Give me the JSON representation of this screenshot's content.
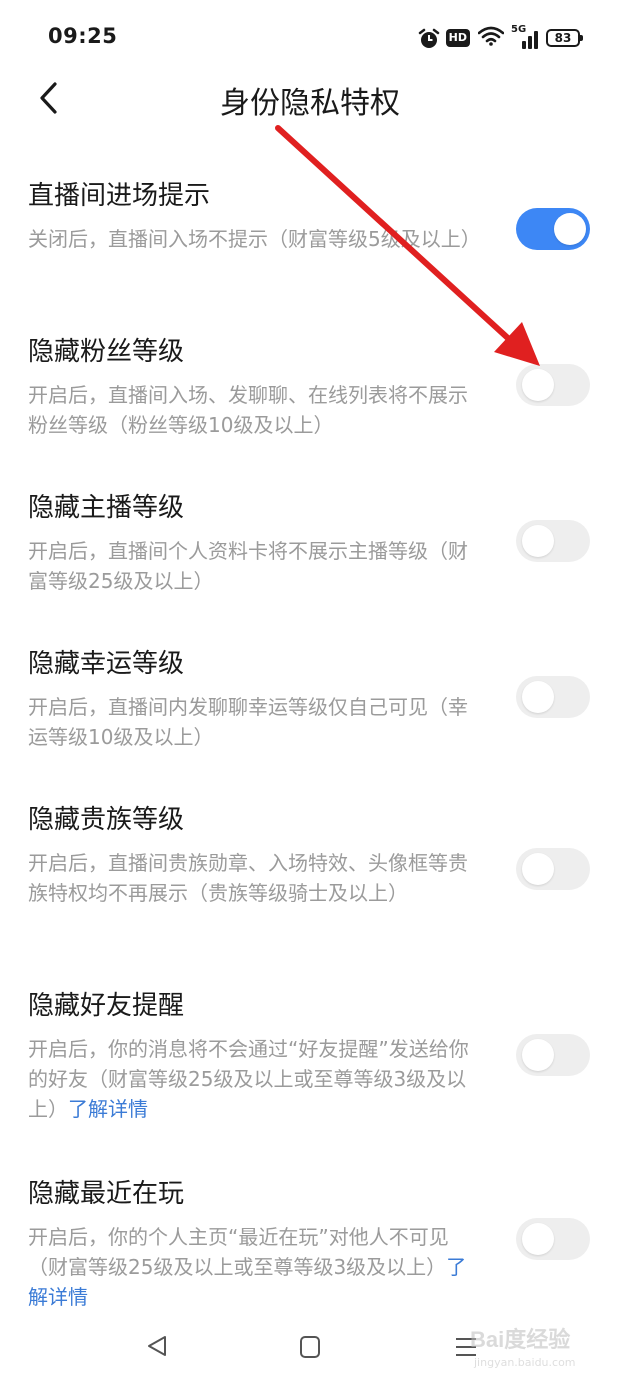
{
  "status_bar": {
    "time": "09:25",
    "icons": [
      "alarm-icon",
      "hd-icon",
      "wifi-icon",
      "cellular-5g-icon",
      "battery-icon"
    ],
    "hd_label": "HD",
    "network_label": "5G",
    "battery_level": "83"
  },
  "nav": {
    "title": "身份隐私特权",
    "back_icon": "chevron-left-icon"
  },
  "colors": {
    "accent": "#3d87f5",
    "toggle_off": "#eeeeee",
    "link": "#3b7bd6",
    "annotation": "#e02020"
  },
  "settings": [
    {
      "title": "直播间进场提示",
      "desc": "关闭后，直播间入场不提示（财富等级5级及以上）",
      "link": "",
      "enabled": true
    },
    {
      "title": "隐藏粉丝等级",
      "desc": "开启后，直播间入场、发聊聊、在线列表将不展示粉丝等级（粉丝等级10级及以上）",
      "link": "",
      "enabled": false
    },
    {
      "title": "隐藏主播等级",
      "desc": "开启后，直播间个人资料卡将不展示主播等级（财富等级25级及以上）",
      "link": "",
      "enabled": false
    },
    {
      "title": "隐藏幸运等级",
      "desc": "开启后，直播间内发聊聊幸运等级仅自己可见（幸运等级10级及以上）",
      "link": "",
      "enabled": false
    },
    {
      "title": "隐藏贵族等级",
      "desc": "开启后，直播间贵族勋章、入场特效、头像框等贵族特权均不再展示（贵族等级骑士及以上）",
      "link": "",
      "enabled": false
    },
    {
      "title": "隐藏好友提醒",
      "desc": "开启后，你的消息将不会通过“好友提醒”发送给你的好友（财富等级25级及以上或至尊等级3级及以上）",
      "link": "了解详情",
      "enabled": false
    },
    {
      "title": "隐藏最近在玩",
      "desc": "开启后，你的个人主页“最近在玩”对他人不可见（财富等级25级及以上或至尊等级3级及以上）",
      "link": "了解详情",
      "enabled": false
    }
  ],
  "system_nav": {
    "icons": [
      "nav-back-triangle-icon",
      "nav-home-square-icon",
      "nav-menu-lines-icon"
    ]
  },
  "watermark": {
    "brand": "Bai度经验",
    "url": "jingyan.baidu.com"
  }
}
